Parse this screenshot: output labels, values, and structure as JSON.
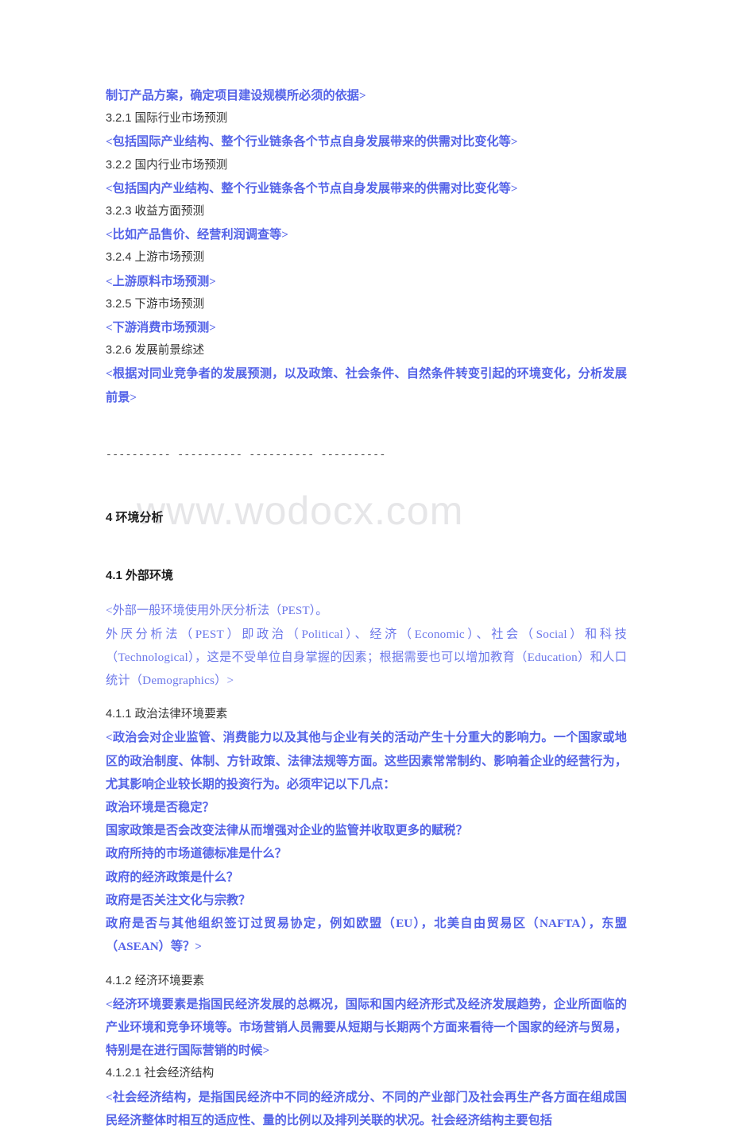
{
  "document": {
    "watermark": "www.wodocx.com",
    "colors": {
      "blue_text": "#5463e8",
      "blue_light": "#6b77ea",
      "heading_text": "#1e1e1e",
      "numbered_heading": "#353535",
      "separator": "#3d3d3d",
      "watermark": "#e6e6e8",
      "page_background": "#ffffff"
    },
    "lines": {
      "l01_continuation": "制订产品方案，确定项目建设规模所必须的依据>",
      "l02_heading": "3.2.1  国际行业市场预测",
      "l03_note": "<包括国际产业结构、整个行业链条各个节点自身发展带来的供需对比变化等>",
      "l04_heading": "3.2.2  国内行业市场预测",
      "l05_note": "<包括国内产业结构、整个行业链条各个节点自身发展带来的供需对比变化等>",
      "l06_heading": "3.2.3  收益方面预测",
      "l07_note": "<比如产品售价、经营利润调查等>",
      "l08_heading": "3.2.4  上游市场预测",
      "l09_note": "<上游原料市场预测>",
      "l10_heading": "3.2.5  下游市场预测",
      "l11_note": "<下游消费市场预测>",
      "l12_heading": "3.2.6  发展前景综述",
      "l13_note": "<根据对同业竞争者的发展预测，以及政策、社会条件、自然条件转变引起的环境变化，分析发展前景>",
      "separator": "---------- ---------- ---------- ----------",
      "h_section4": "4  环境分析",
      "h_section41": "4.1  外部环境",
      "l14_note_a": "<外部一般环境使用外厌分析法（PEST）。",
      "l14_note_b": "外厌分析法（PEST）即政治（Political）、经济（Economic）、社会（Social）和科技（Technological），这是不受单位自身掌握的因素；根据需要也可以增加教育（Education）和人口统计（Demographics）>",
      "h_411": "4.1.1  政治法律环境要素",
      "l15_note": "<政治会对企业监管、消费能力以及其他与企业有关的活动产生十分重大的影响力。一个国家或地区的政治制度、体制、方针政策、法律法规等方面。这些因素常常制约、影响着企业的经营行为，尤其影响企业较长期的投资行为。必须牢记以下几点：",
      "l16_q1": "政治环境是否稳定？",
      "l17_q2": "国家政策是否会改变法律从而增强对企业的监管并收取更多的赋税？",
      "l18_q3": "政府所持的市场道德标准是什么？",
      "l19_q4": "政府的经济政策是什么？",
      "l20_q5": "政府是否关注文化与宗教？",
      "l21_q6": "政府是否与其他组织签订过贸易协定，例如欧盟（EU），北美自由贸易区（NAFTA），东盟（ASEAN）等？>",
      "h_412": "4.1.2  经济环境要素",
      "l22_note": "<经济环境要素是指国民经济发展的总概况，国际和国内经济形式及经济发展趋势，企业所面临的产业环境和竞争环境等。市场营销人员需要从短期与长期两个方面来看待一个国家的经济与贸易，特别是在进行国际营销的时候>",
      "h_4121": "4.1.2.1  社会经济结构",
      "l23_note": "<社会经济结构，是指国民经济中不同的经济成分、不同的产业部门及社会再生产各方面在组成国民经济整体时相互的适应性、量的比例以及排列关联的状况。社会经济结构主要包括"
    }
  }
}
